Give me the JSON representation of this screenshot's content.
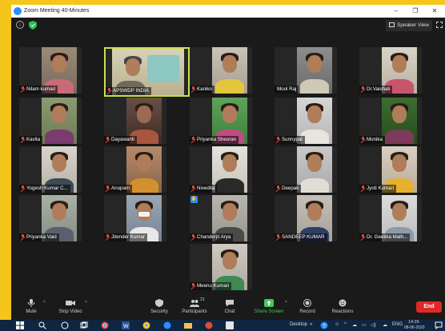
{
  "window": {
    "title": "Zoom Meeting 40-Minutes",
    "minimize": "–",
    "maximize": "❐",
    "close": "✕"
  },
  "topbar": {
    "view_label": "Speaker View"
  },
  "participants": [
    {
      "name": "Nilam kumari"
    },
    {
      "name": "APSWDP INDIA"
    },
    {
      "name": "Kaniko"
    },
    {
      "name": "Mool Raj"
    },
    {
      "name": "Dr.Vaishali"
    },
    {
      "name": "Kavita"
    },
    {
      "name": "Dayawanti"
    },
    {
      "name": "Priyanka Sheoran"
    },
    {
      "name": "Sunnypal"
    },
    {
      "name": "Monika"
    },
    {
      "name": "Yogesh Kumar C..."
    },
    {
      "name": "Anupam"
    },
    {
      "name": "Nivedita"
    },
    {
      "name": "Deepak"
    },
    {
      "name": "Jyoti Kumari"
    },
    {
      "name": "Priyanka Vaid"
    },
    {
      "name": "Jitender Kumar"
    },
    {
      "name": "Chanderjit Arya"
    },
    {
      "name": "SANDEEP KUMAR"
    },
    {
      "name": "Dr. Geetika Malh..."
    },
    {
      "name": "Meenu Kumari"
    }
  ],
  "toolbar": {
    "mute": "Mute",
    "stop_video": "Stop Video",
    "security": "Security",
    "participants": "Participants",
    "participants_count": "21",
    "chat": "Chat",
    "share_screen": "Share Screen",
    "record": "Record",
    "reactions": "Reactions",
    "end": "End"
  },
  "taskbar": {
    "desktop_label": "Desktop",
    "language": "ENG",
    "time": "14:26",
    "date": "08-06-2020"
  },
  "colors": {
    "accent_blue": "#2d8cff",
    "active_border": "#c8e04a",
    "end_red": "#e02828",
    "share_green": "#3fca56"
  }
}
